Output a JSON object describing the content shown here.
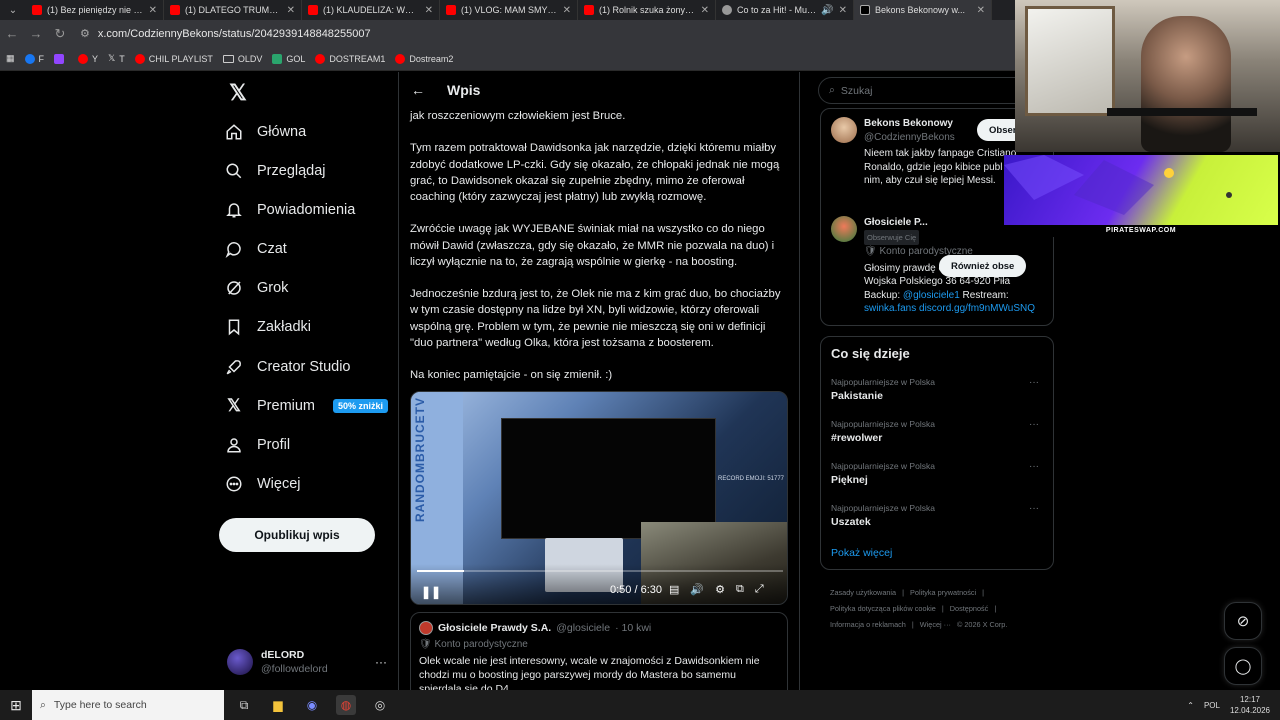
{
  "browser": {
    "tabs": [
      {
        "title": "(1) Bez pieniędzy nie ma...",
        "icon": "youtube-icon"
      },
      {
        "title": "(1) DLATEGO TRUMP CHC...",
        "icon": "youtube-icon"
      },
      {
        "title": "(1) KLAUDELIZA: WOLBRO...",
        "icon": "youtube-icon"
      },
      {
        "title": "(1) VLOG: MAM SMYKAŁ...",
        "icon": "youtube-icon"
      },
      {
        "title": "(1) Rolnik szuka żony - Yo...",
        "icon": "youtube-icon"
      },
      {
        "title": "Co to za Hit! - Muzyczny...",
        "icon": "globe-icon"
      },
      {
        "title": "Bekons Bekonowy w...",
        "icon": "x-icon"
      }
    ],
    "url": "x.com/CodziennyBekons/status/2042939148848255007",
    "bookmarks": [
      "F",
      "",
      "Y",
      "T",
      "CHIL PLAYLIST",
      "OLDV",
      "GOL",
      "DOSTREAM1",
      "Dostream2"
    ]
  },
  "nav": {
    "items": [
      {
        "label": "Główna",
        "icon": "home-icon"
      },
      {
        "label": "Przeglądaj",
        "icon": "search-icon"
      },
      {
        "label": "Powiadomienia",
        "icon": "bell-icon"
      },
      {
        "label": "Czat",
        "icon": "chat-icon"
      },
      {
        "label": "Grok",
        "icon": "grok-icon"
      },
      {
        "label": "Zakładki",
        "icon": "bookmark-icon"
      },
      {
        "label": "Creator Studio",
        "icon": "rocket-icon"
      },
      {
        "label": "Premium",
        "icon": "x-icon"
      },
      {
        "label": "Profil",
        "icon": "person-icon"
      },
      {
        "label": "Więcej",
        "icon": "more-circle-icon"
      }
    ],
    "premium_badge": "50% zniżki",
    "publish_label": "Opublikuj wpis",
    "account": {
      "name": "dELORD",
      "handle": "@followdelord"
    }
  },
  "main": {
    "header_title": "Wpis",
    "paragraphs": [
      "jak roszczeniowym człowiekiem jest Bruce.",
      "Tym razem potraktował Dawidsonka jak narzędzie, dzięki któremu miałby zdobyć dodatkowe LP-czki. Gdy się okazało, że chłopaki jednak nie mogą grać, to Dawidsonek okazał się zupełnie zbędny, mimo że oferował coaching (który zazwyczaj jest płatny) lub zwykłą rozmowę.",
      "Zwróćcie uwagę jak WYJEBANE świniak miał na wszystko co do niego mówił Dawid (zwłaszcza, gdy się okazało, że MMR nie pozwala na duo) i liczył wyłącznie na to, że zagrają wspólnie w gierkę - na boosting.",
      "Jednocześnie bzdurą jest to, że Olek nie ma z kim grać duo, bo chociażby w tym czasie dostępny na lidze był XN, byli widzowie, którzy oferowali wspólną grę. Problem w tym, że pewnie nie mieszczą się oni w definicji \"duo partnera\" według Olka, która jest tożsama z boosterem.",
      "Na koniec pamiętajcie - on się zmienił. :)"
    ],
    "video": {
      "side_text": "RANDOMBRUCETV",
      "record_text": "RECORD EMOJI: 51777",
      "time": "0:50 / 6:30",
      "progress": 0.128
    },
    "reply": {
      "name": "Głosiciele Prawdy S.A.",
      "handle": "@glosiciele",
      "time": "· 10 kwi",
      "parody_label": "Konto parodystyczne",
      "text": "Olek wcale nie jest interesowny, wcale w znajomości z Dawidsonkiem nie chodzi mu o boosting jego parszywej mordy do Mastera bo samemu spierdala się do D4."
    }
  },
  "right": {
    "search_placeholder": "Szukaj",
    "profile1": {
      "name": "Bekons Bekonowy",
      "handle": "@CodziennyBekons",
      "follow_label": "Obser",
      "bio": "Nieem tak jakby fanpage Cristiano Ronaldo, gdzie jego kibice publ treści o nim, aby czuł się lepiej Messi."
    },
    "profile2": {
      "name": "Głosiciele P...",
      "follows_you": "Obserwuje Cię",
      "follow_label": "Również obse",
      "parody_label": "Konto parodystyczne",
      "bio": "Głosimy prawdę o streamerze z Piły Wojska Polskiego 36 64-920 Piła Backup: ",
      "bio_link1": "@glosiciele1",
      "bio_mid": " Restream: ",
      "bio_link2": "swinka.fans discord.gg/fm9nMWuSNQ"
    },
    "trends_title": "Co się dzieje",
    "trends": [
      {
        "category": "Najpopularniejsze w Polska",
        "name": "Pakistanie"
      },
      {
        "category": "Najpopularniejsze w Polska",
        "name": "#rewolwer"
      },
      {
        "category": "Najpopularniejsze w Polska",
        "name": "Pięknej"
      },
      {
        "category": "Najpopularniejsze w Polska",
        "name": "Uszatek"
      }
    ],
    "show_more": "Pokaż więcej",
    "footer": [
      "Zasady użytkowania",
      "|",
      "Polityka prywatności",
      "|",
      "Polityka dotycząca plików cookie",
      "|",
      "Dostępność",
      "|",
      "Informacja o reklamach",
      "|",
      "Więcej ···",
      "© 2026 X Corp."
    ]
  },
  "overlay": {
    "ad_caption": "PIRATESWAP.COM"
  },
  "taskbar": {
    "search_placeholder": "Type here to search",
    "lang": "POL",
    "time": "12:17",
    "date": "12.04.2026"
  }
}
